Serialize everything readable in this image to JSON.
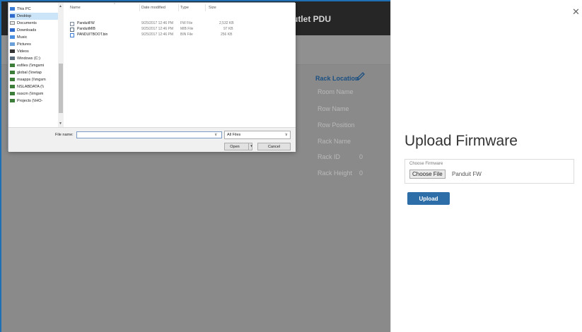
{
  "background_page": {
    "header_title": "utlet PDU",
    "left_label": "",
    "rack": {
      "title": "Rack Location",
      "fields": [
        {
          "label": "Room Name",
          "value": ""
        },
        {
          "label": "Row Name",
          "value": ""
        },
        {
          "label": "Row Position",
          "value": ""
        },
        {
          "label": "Rack Name",
          "value": ""
        },
        {
          "label": "Rack ID",
          "value": "0"
        },
        {
          "label": "Rack Height",
          "value": "0"
        }
      ]
    }
  },
  "upload_panel": {
    "title": "Upload Firmware",
    "choose_label": "Choose Firmware",
    "choose_button": "Choose File",
    "selected_file": "Panduit FW",
    "upload_button": "Upload",
    "close_glyph": "✕"
  },
  "file_dialog": {
    "nav_items": [
      {
        "label": "This PC",
        "icon": "computer-icon",
        "selected": false
      },
      {
        "label": "Desktop",
        "icon": "folder-icon",
        "selected": true
      },
      {
        "label": "Documents",
        "icon": "documents-icon",
        "selected": false
      },
      {
        "label": "Downloads",
        "icon": "download-icon",
        "selected": false
      },
      {
        "label": "Music",
        "icon": "music-icon",
        "selected": false
      },
      {
        "label": "Pictures",
        "icon": "pictures-icon",
        "selected": false
      },
      {
        "label": "Videos",
        "icon": "videos-icon",
        "selected": false
      },
      {
        "label": "Windows (C:)",
        "icon": "drive-icon",
        "selected": false
      },
      {
        "label": "esfiles (\\\\mgsmi",
        "icon": "network-drive-icon",
        "selected": false
      },
      {
        "label": "global (\\\\netap",
        "icon": "network-drive-icon",
        "selected": false
      },
      {
        "label": "msapps (\\\\mgsm",
        "icon": "network-drive-icon",
        "selected": false
      },
      {
        "label": "NSLABDATA (\\\\",
        "icon": "network-drive-icon",
        "selected": false
      },
      {
        "label": "nsscm (\\\\mgsm",
        "icon": "network-drive-icon",
        "selected": false
      },
      {
        "label": "Projects (\\\\HO-",
        "icon": "network-drive-icon",
        "selected": false
      }
    ],
    "columns": {
      "name": "Name",
      "date": "Date modified",
      "type": "Type",
      "size": "Size"
    },
    "files": [
      {
        "name": "PanduitFW",
        "date": "9/25/2017 12:46 PM",
        "type": "FW File",
        "size": "2,532 KB"
      },
      {
        "name": "PanduitMIB",
        "date": "9/25/2017 12:46 PM",
        "type": "MIB File",
        "size": "97 KB"
      },
      {
        "name": "PANDUITBOOT.bin",
        "date": "9/25/2017 12:46 PM",
        "type": "BIN File",
        "size": "256 KB"
      }
    ],
    "filename_label": "File name:",
    "filename_value": "",
    "filter_value": "All Files",
    "open_button": "Open",
    "cancel_button": "Cancel"
  },
  "colors": {
    "accent": "#2d6ea8",
    "overlay": "#8a8a8a",
    "header": "#262626",
    "rack_title": "#1a4f82"
  }
}
